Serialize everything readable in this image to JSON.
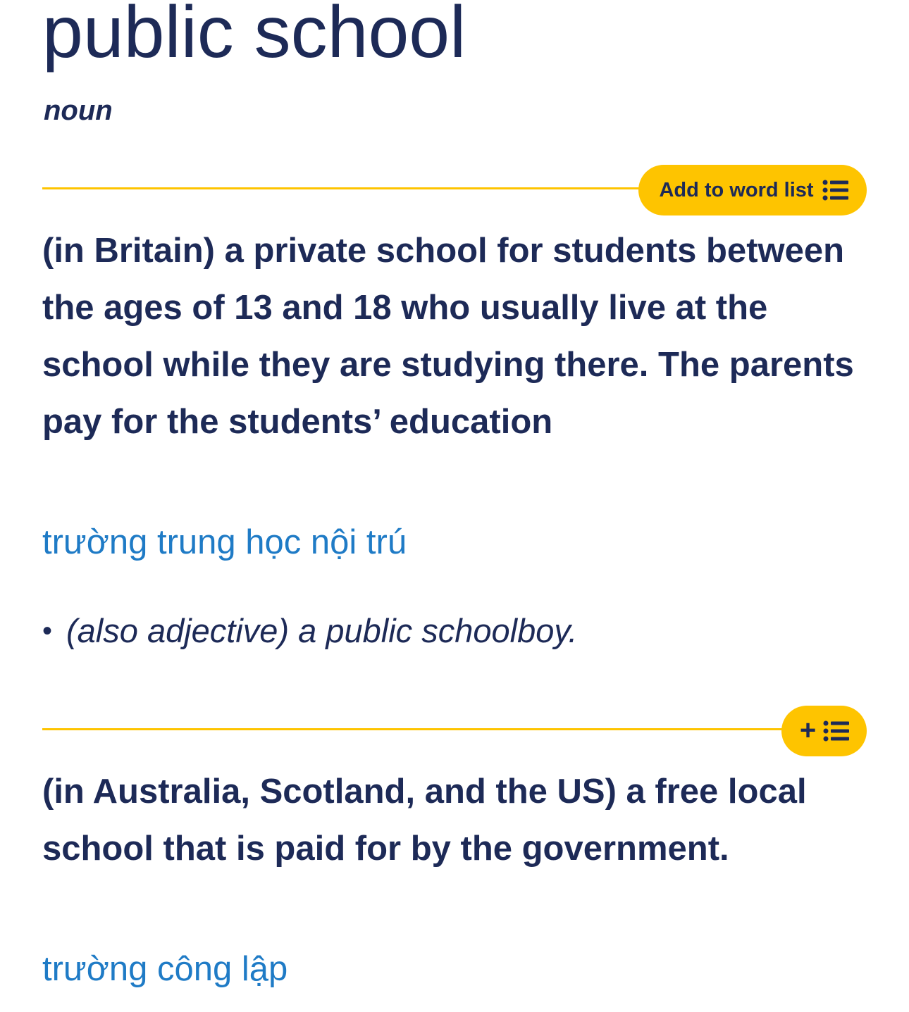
{
  "entry": {
    "headword": "public school",
    "part_of_speech": "noun"
  },
  "senses": [
    {
      "button_label": "Add to word list",
      "button_icon": "list-icon",
      "definition": "(in Britain) a private school for students between the ages of 13 and 18 who usually live at the school while they are studying there. The parents pay for the students’ education",
      "translation": "trường trung học nội trú",
      "example": {
        "bullet": "•",
        "text": "(also adjective) a public schoolboy."
      }
    },
    {
      "button_label": "+",
      "button_icon": "list-icon",
      "definition": "(in Australia, Scotland, and the US) a free local school that is paid for by the government.",
      "translation": "trường công lập"
    }
  ],
  "colors": {
    "text": "#1d2a57",
    "accent": "#fec400",
    "translation": "#1f7bc6",
    "background": "#ffffff"
  }
}
